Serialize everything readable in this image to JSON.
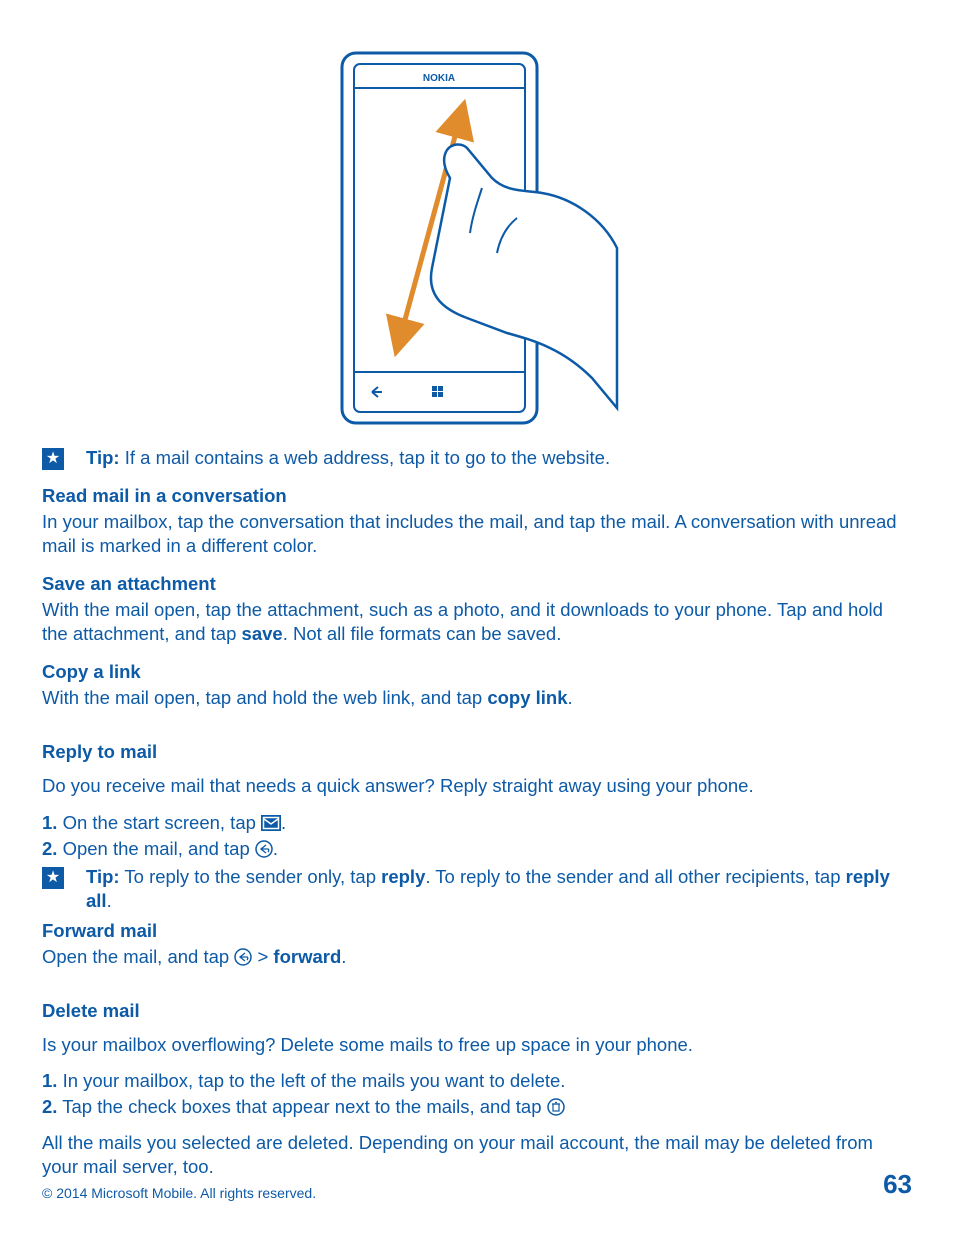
{
  "phone_brand": "NOKIA",
  "tip1": {
    "label": "Tip:",
    "text": " If a mail contains a web address, tap it to go to the website."
  },
  "read_mail": {
    "heading": "Read mail in a conversation",
    "body": "In your mailbox, tap the conversation that includes the mail, and tap the mail. A conversation with unread mail is marked in a different color."
  },
  "save_attach": {
    "heading": "Save an attachment",
    "body_a": "With the mail open, tap the attachment, such as a photo, and it downloads to your phone. Tap and hold the attachment, and tap ",
    "save": "save",
    "body_b": ". Not all file formats can be saved."
  },
  "copy_link": {
    "heading": "Copy a link",
    "body_a": "With the mail open, tap and hold the web link, and tap ",
    "action": "copy link",
    "body_b": "."
  },
  "reply": {
    "heading": "Reply to mail",
    "intro": "Do you receive mail that needs a quick answer? Reply straight away using your phone.",
    "step1_num": "1.",
    "step1_a": " On the start screen, tap ",
    "step1_b": ".",
    "step2_num": "2.",
    "step2_a": " Open the mail, and tap ",
    "step2_b": "."
  },
  "tip2": {
    "label": "Tip:",
    "text_a": " To reply to the sender only, tap ",
    "reply": "reply",
    "text_b": ". To reply to the sender and all other recipients, tap ",
    "reply_all": "reply all",
    "text_c": "."
  },
  "forward": {
    "heading": "Forward mail",
    "body_a": "Open the mail, and tap ",
    "gt": " > ",
    "action": "forward",
    "body_b": "."
  },
  "delete": {
    "heading": "Delete mail",
    "intro": "Is your mailbox overflowing? Delete some mails to free up space in your phone.",
    "step1_num": "1.",
    "step1": " In your mailbox, tap to the left of the mails you want to delete.",
    "step2_num": "2.",
    "step2": " Tap the check boxes that appear next to the mails, and tap ",
    "after": "All the mails you selected are deleted. Depending on your mail account, the mail may be deleted from your mail server, too."
  },
  "footer": {
    "copyright": "© 2014 Microsoft Mobile. All rights reserved.",
    "page": "63"
  }
}
